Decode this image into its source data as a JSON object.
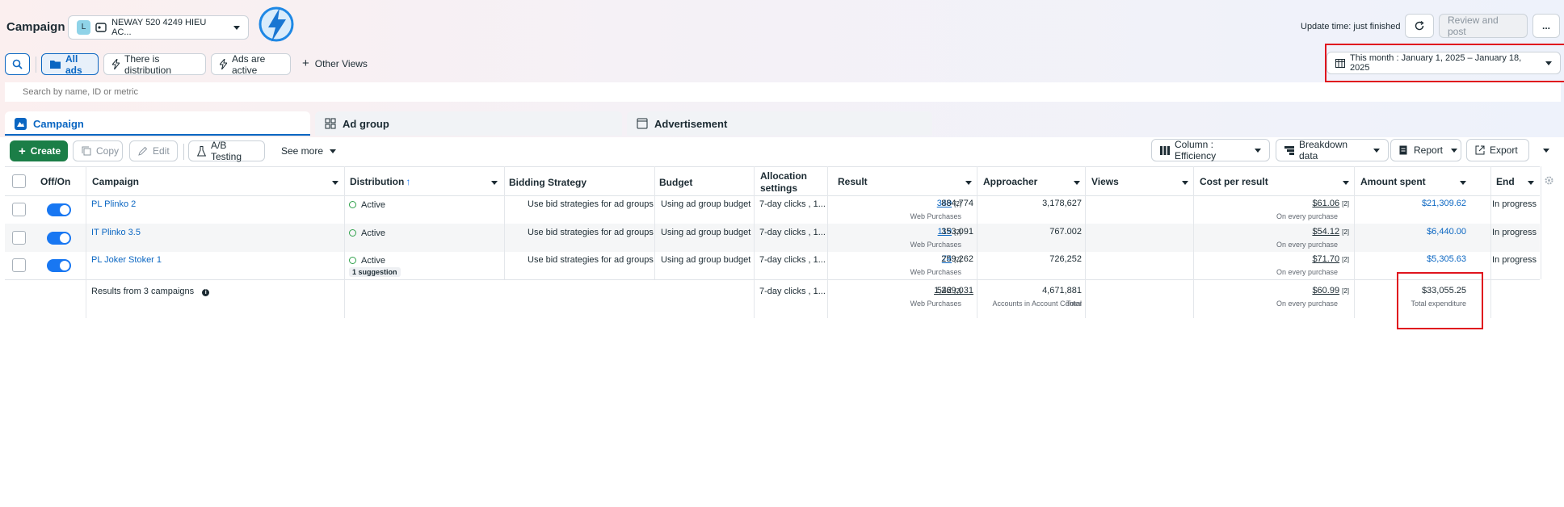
{
  "header": {
    "title": "Campaign",
    "account_badge": "L",
    "account_name": "NEWAY 520 4249 HIEU AC...",
    "update_time": "Update time: just finished",
    "review_button": "Review and post",
    "more_button": "..."
  },
  "views": {
    "all_ads": "All ads",
    "distribution": "There is distribution",
    "ads_active": "Ads are active",
    "other_views": "Other Views",
    "date_range": "This month : January 1, 2025 – January 18, 2025"
  },
  "search": {
    "placeholder": "Search by name, ID or metric"
  },
  "tabs": {
    "campaign": "Campaign",
    "ad_group": "Ad group",
    "advertisement": "Advertisement"
  },
  "toolbar": {
    "create": "Create",
    "copy": "Copy",
    "edit": "Edit",
    "ab_testing": "A/B Testing",
    "see_more": "See more",
    "column": "Column : Efficiency",
    "breakdown": "Breakdown data",
    "report": "Report",
    "export": "Export"
  },
  "columns": {
    "off_on": "Off/On",
    "campaign": "Campaign",
    "distribution": "Distribution",
    "bidding": "Bidding Strategy",
    "budget": "Budget",
    "allocation_1": "Allocation",
    "allocation_2": "settings",
    "result": "Result",
    "approacher": "Approacher",
    "views": "Views",
    "cost_per_result": "Cost per result",
    "amount_spent": "Amount spent",
    "end": "End"
  },
  "rows": [
    {
      "name": "PL Plinko 2",
      "distribution": "Active",
      "bidding": "Use bid strategies for ad groups",
      "budget": "Using ad group budget",
      "allocation": "7-day clicks , 1...",
      "result": "349",
      "result_note": "[2]",
      "result_sub": "Web Purchases",
      "approacher": "884,774",
      "views": "3,178,627",
      "cost": "$61.06",
      "cost_note": "[2]",
      "cost_sub": "On every purchase",
      "spent": "$21,309.62",
      "end": "In progress"
    },
    {
      "name": "IT Plinko 3.5",
      "distribution": "Active",
      "bidding": "Use bid strategies for ad groups",
      "budget": "Using ad group budget",
      "allocation": "7-day clicks , 1...",
      "result": "119",
      "result_note": "[2]",
      "result_sub": "Web Purchases",
      "approacher": "353,091",
      "views": "767.002",
      "cost": "$54.12",
      "cost_note": "[2]",
      "cost_sub": "On every purchase",
      "spent": "$6,440.00",
      "end": "In progress"
    },
    {
      "name": "PL Joker Stoker 1",
      "distribution": "Active",
      "suggestion": "1 suggestion",
      "bidding": "Use bid strategies for ad groups",
      "budget": "Using ad group budget",
      "allocation": "7-day clicks , 1...",
      "result": "74",
      "result_note": "[2]",
      "result_sub": "Web Purchases",
      "approacher": "259,262",
      "views": "726,252",
      "cost": "$71.70",
      "cost_note": "[2]",
      "cost_sub": "On every purchase",
      "spent": "$5,305.63",
      "end": "In progress"
    }
  ],
  "totals": {
    "label": "Results from 3 campaigns",
    "allocation": "7-day clicks , 1...",
    "result": "542",
    "result_note": "[2]",
    "result_sub": "Web Purchases",
    "approacher": "1,269,031",
    "approacher_sub": "Accounts in Account Center",
    "views": "4,671,881",
    "views_sub": "Total",
    "cost": "$60.99",
    "cost_note": "[2]",
    "cost_sub": "On every purchase",
    "spent": "$33,055.25",
    "spent_sub": "Total expenditure"
  },
  "colors": {
    "primary": "#0a66c2",
    "create": "#1b7e47",
    "toggle": "#1877f2",
    "highlight": "#e0141e"
  }
}
